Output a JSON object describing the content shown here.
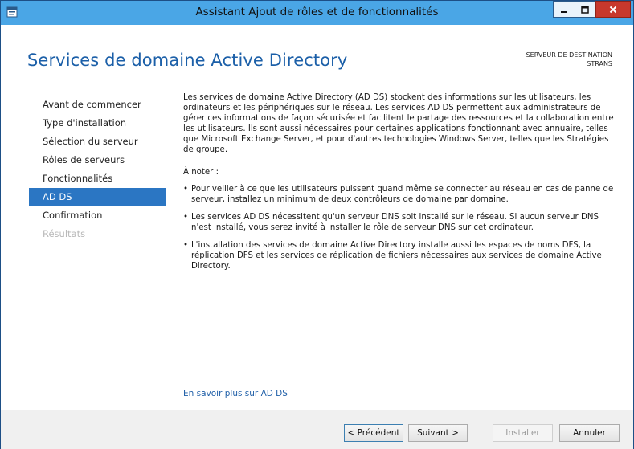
{
  "window": {
    "title": "Assistant Ajout de rôles et de fonctionnalités"
  },
  "header": {
    "title": "Services de domaine Active Directory",
    "destination_label": "SERVEUR DE DESTINATION",
    "destination_server": "STRANS"
  },
  "nav": {
    "items": [
      {
        "label": "Avant de commencer",
        "state": "normal"
      },
      {
        "label": "Type d'installation",
        "state": "normal"
      },
      {
        "label": "Sélection du serveur",
        "state": "normal"
      },
      {
        "label": "Rôles de serveurs",
        "state": "normal"
      },
      {
        "label": "Fonctionnalités",
        "state": "normal"
      },
      {
        "label": "AD DS",
        "state": "selected"
      },
      {
        "label": "Confirmation",
        "state": "normal"
      },
      {
        "label": "Résultats",
        "state": "disabled"
      }
    ]
  },
  "content": {
    "intro": "Les services de domaine Active Directory (AD DS) stockent des informations sur les utilisateurs, les ordinateurs et les périphériques sur le réseau. Les services AD DS permettent aux administrateurs de gérer ces informations de façon sécurisée et facilitent le partage des ressources et la collaboration entre les utilisateurs. Ils sont aussi nécessaires pour certaines applications fonctionnant avec annuaire, telles que Microsoft Exchange Server, et pour d'autres technologies Windows Server, telles que les Stratégies de groupe.",
    "note_heading": "À noter :",
    "notes": [
      "Pour veiller à ce que les utilisateurs puissent quand même se connecter au réseau en cas de panne de serveur, installez un minimum de deux contrôleurs de domaine par domaine.",
      "Les services AD DS nécessitent qu'un serveur DNS soit installé sur le réseau. Si aucun serveur DNS n'est installé, vous serez invité à installer le rôle de serveur DNS sur cet ordinateur.",
      "L'installation des services de domaine Active Directory installe aussi les espaces de noms DFS, la réplication DFS et les services de réplication de fichiers nécessaires aux services de domaine Active Directory."
    ],
    "more_link": "En savoir plus sur AD DS"
  },
  "footer": {
    "previous": "< Précédent",
    "next": "Suivant >",
    "install": "Installer",
    "cancel": "Annuler"
  },
  "colors": {
    "accent": "#2b76c3",
    "titlebar": "#4aa6e6",
    "close": "#c7382c",
    "title_text": "#1b5fa8"
  }
}
